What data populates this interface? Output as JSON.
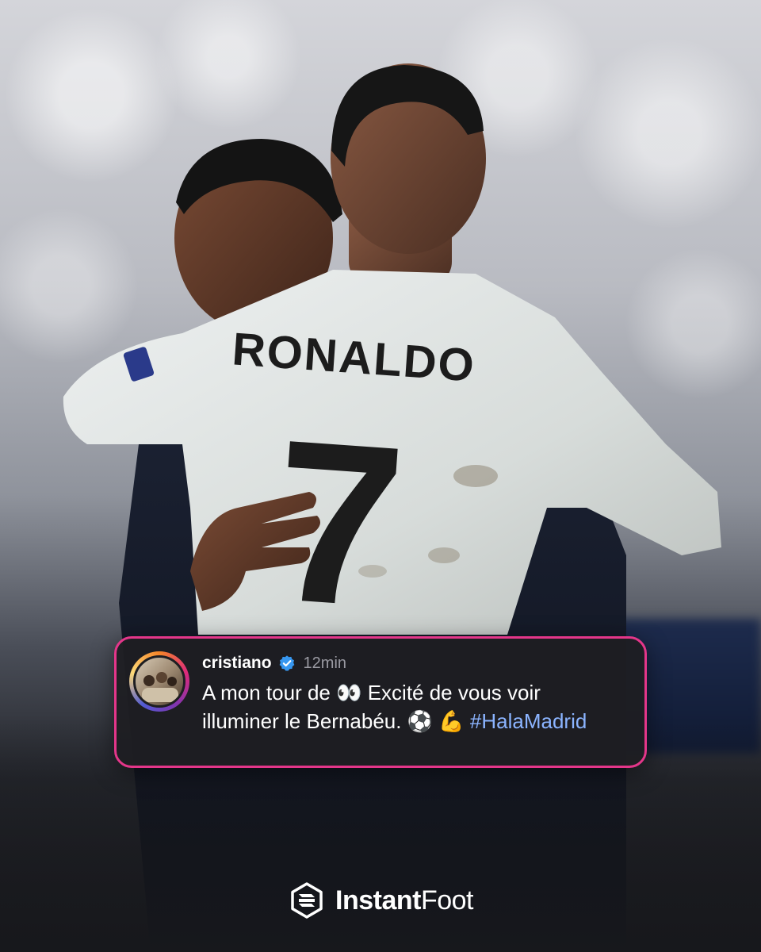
{
  "post": {
    "jersey_name": "RONALDO",
    "jersey_number": "7"
  },
  "caption": {
    "username": "cristiano",
    "time": "12min",
    "text_line1": "A mon tour de 👀 Excité de vous voir",
    "text_line2_prefix": "illuminer le Bernabéu. ⚽️ 💪",
    "hashtag": "#HalaMadrid"
  },
  "brand": {
    "name_bold": "Instant",
    "name_regular": "Foot"
  },
  "colors": {
    "card_border": "#e4368a",
    "hashtag": "#8bb4ff",
    "verified": "#3797f0"
  }
}
